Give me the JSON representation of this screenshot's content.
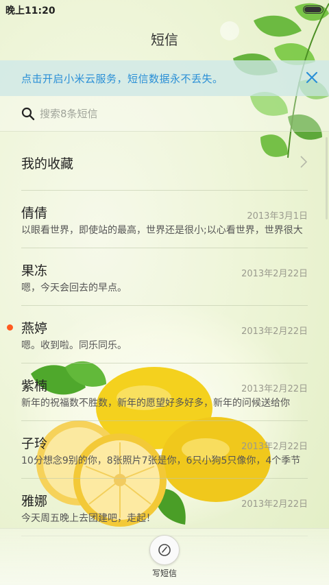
{
  "status_bar": {
    "time": "晚上11:20",
    "battery_level": 0.95
  },
  "header": {
    "title": "短信"
  },
  "banner": {
    "text": "点击开启小米云服务，短信数据永不丢失。",
    "accent_color": "#2a8fd6"
  },
  "search": {
    "placeholder": "搜索8条短信"
  },
  "favorites": {
    "label": "我的收藏"
  },
  "conversations": [
    {
      "name": "倩倩",
      "date": "2013年3月1日",
      "preview": "以眼看世界，即使站的最高，世界还是很小;以心看世界，世界很大",
      "unread": false
    },
    {
      "name": "果冻",
      "date": "2013年2月22日",
      "preview": "嗯，今天会回去的早点。",
      "unread": false
    },
    {
      "name": "燕婷",
      "date": "2013年2月22日",
      "preview": "嗯。收到啦。同乐同乐。",
      "unread": true
    },
    {
      "name": "紫楠",
      "date": "2013年2月22日",
      "preview": "新年的祝福数不胜数，新年的愿望好多好多，新年的问候送给你",
      "unread": false
    },
    {
      "name": "子玲",
      "date": "2013年2月22日",
      "preview": "10分想念9别的你，8张照片7张是你，6只小狗5只像你，4个季节",
      "unread": false
    },
    {
      "name": "雅娜",
      "date": "2013年2月22日",
      "preview": "今天周五晚上去团建吧，走起！",
      "unread": false
    }
  ],
  "compose": {
    "label": "写短信",
    "icon": "compose-icon"
  },
  "colors": {
    "unread_dot": "#ff5a1f",
    "background": "#eef5d8"
  }
}
